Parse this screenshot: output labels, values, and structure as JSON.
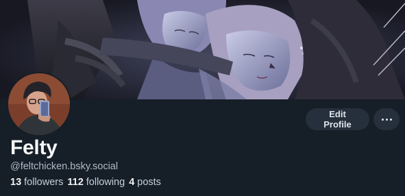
{
  "profile": {
    "display_name": "Felty",
    "handle": "@feltchicken.bsky.social",
    "stats": {
      "followers_count": "13",
      "followers_label": "followers",
      "following_count": "112",
      "following_label": "following",
      "posts_count": "4",
      "posts_label": "posts"
    }
  },
  "actions": {
    "edit_label": "Edit Profile",
    "more_icon": "ellipsis-icon"
  },
  "colors": {
    "background": "#161e27",
    "button_bg": "#26303c",
    "handle_text": "#aebbc9"
  }
}
